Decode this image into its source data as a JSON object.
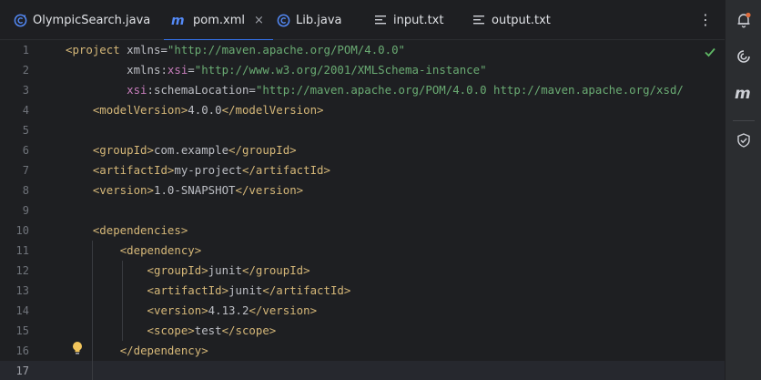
{
  "tabs": [
    {
      "label": "OlympicSearch.java",
      "icon": "java-class-icon",
      "active": false
    },
    {
      "label": "pom.xml",
      "icon": "maven-icon",
      "active": true,
      "close": "×"
    },
    {
      "label": "Lib.java",
      "icon": "java-class-icon",
      "active": false
    },
    {
      "label": "input.txt",
      "icon": "text-file-icon",
      "active": false
    },
    {
      "label": "output.txt",
      "icon": "text-file-icon",
      "active": false
    }
  ],
  "more_label": "⋮",
  "editor": {
    "current_line": 17,
    "lines": [
      {
        "n": "1",
        "tokens": [
          [
            "tag",
            "<project "
          ],
          [
            "attr",
            "xmlns"
          ],
          [
            "attr",
            "="
          ],
          [
            "str",
            "\"http://maven.apache.org/POM/4.0.0\""
          ]
        ]
      },
      {
        "n": "2",
        "tokens": [
          [
            "txt",
            "         "
          ],
          [
            "attr",
            "xmlns:"
          ],
          [
            "ns",
            "xsi"
          ],
          [
            "attr",
            "="
          ],
          [
            "str",
            "\"http://www.w3.org/2001/XMLSchema-instance\""
          ]
        ]
      },
      {
        "n": "3",
        "tokens": [
          [
            "txt",
            "         "
          ],
          [
            "ns",
            "xsi"
          ],
          [
            "attr",
            ":schemaLocation="
          ],
          [
            "str",
            "\"http://maven.apache.org/POM/4.0.0 http://maven.apache.org/xsd/"
          ]
        ]
      },
      {
        "n": "4",
        "tokens": [
          [
            "txt",
            "    "
          ],
          [
            "tag",
            "<modelVersion>"
          ],
          [
            "txt",
            "4.0.0"
          ],
          [
            "tag",
            "</modelVersion>"
          ]
        ]
      },
      {
        "n": "5",
        "tokens": []
      },
      {
        "n": "6",
        "tokens": [
          [
            "txt",
            "    "
          ],
          [
            "tag",
            "<groupId>"
          ],
          [
            "txt",
            "com.example"
          ],
          [
            "tag",
            "</groupId>"
          ]
        ]
      },
      {
        "n": "7",
        "tokens": [
          [
            "txt",
            "    "
          ],
          [
            "tag",
            "<artifactId>"
          ],
          [
            "txt",
            "my-project"
          ],
          [
            "tag",
            "</artifactId>"
          ]
        ]
      },
      {
        "n": "8",
        "tokens": [
          [
            "txt",
            "    "
          ],
          [
            "tag",
            "<version>"
          ],
          [
            "txt",
            "1.0-SNAPSHOT"
          ],
          [
            "tag",
            "</version>"
          ]
        ]
      },
      {
        "n": "9",
        "tokens": []
      },
      {
        "n": "10",
        "tokens": [
          [
            "txt",
            "    "
          ],
          [
            "tag",
            "<dependencies>"
          ]
        ]
      },
      {
        "n": "11",
        "tokens": [
          [
            "txt",
            "        "
          ],
          [
            "tag",
            "<dependency>"
          ]
        ]
      },
      {
        "n": "12",
        "tokens": [
          [
            "txt",
            "            "
          ],
          [
            "tag",
            "<groupId>"
          ],
          [
            "txt",
            "junit"
          ],
          [
            "tag",
            "</groupId>"
          ]
        ]
      },
      {
        "n": "13",
        "tokens": [
          [
            "txt",
            "            "
          ],
          [
            "tag",
            "<artifactId>"
          ],
          [
            "txt",
            "junit"
          ],
          [
            "tag",
            "</artifactId>"
          ]
        ]
      },
      {
        "n": "14",
        "tokens": [
          [
            "txt",
            "            "
          ],
          [
            "tag",
            "<version>"
          ],
          [
            "txt",
            "4.13.2"
          ],
          [
            "tag",
            "</version>"
          ]
        ]
      },
      {
        "n": "15",
        "tokens": [
          [
            "txt",
            "            "
          ],
          [
            "tag",
            "<scope>"
          ],
          [
            "txt",
            "test"
          ],
          [
            "tag",
            "</scope>"
          ]
        ]
      },
      {
        "n": "16",
        "tokens": [
          [
            "txt",
            "        "
          ],
          [
            "tag",
            "</dependency>"
          ]
        ]
      },
      {
        "n": "17",
        "tokens": []
      }
    ]
  },
  "right_toolbar": [
    {
      "name": "notifications-icon"
    },
    {
      "name": "ai-assistant-icon"
    },
    {
      "name": "maven-tool-icon"
    },
    {
      "name": "security-shield-icon"
    }
  ],
  "colors": {
    "background": "#1e1f22",
    "accent": "#3574f0",
    "tag": "#d5b778",
    "string": "#6aab73",
    "namespace": "#c77dbb"
  }
}
